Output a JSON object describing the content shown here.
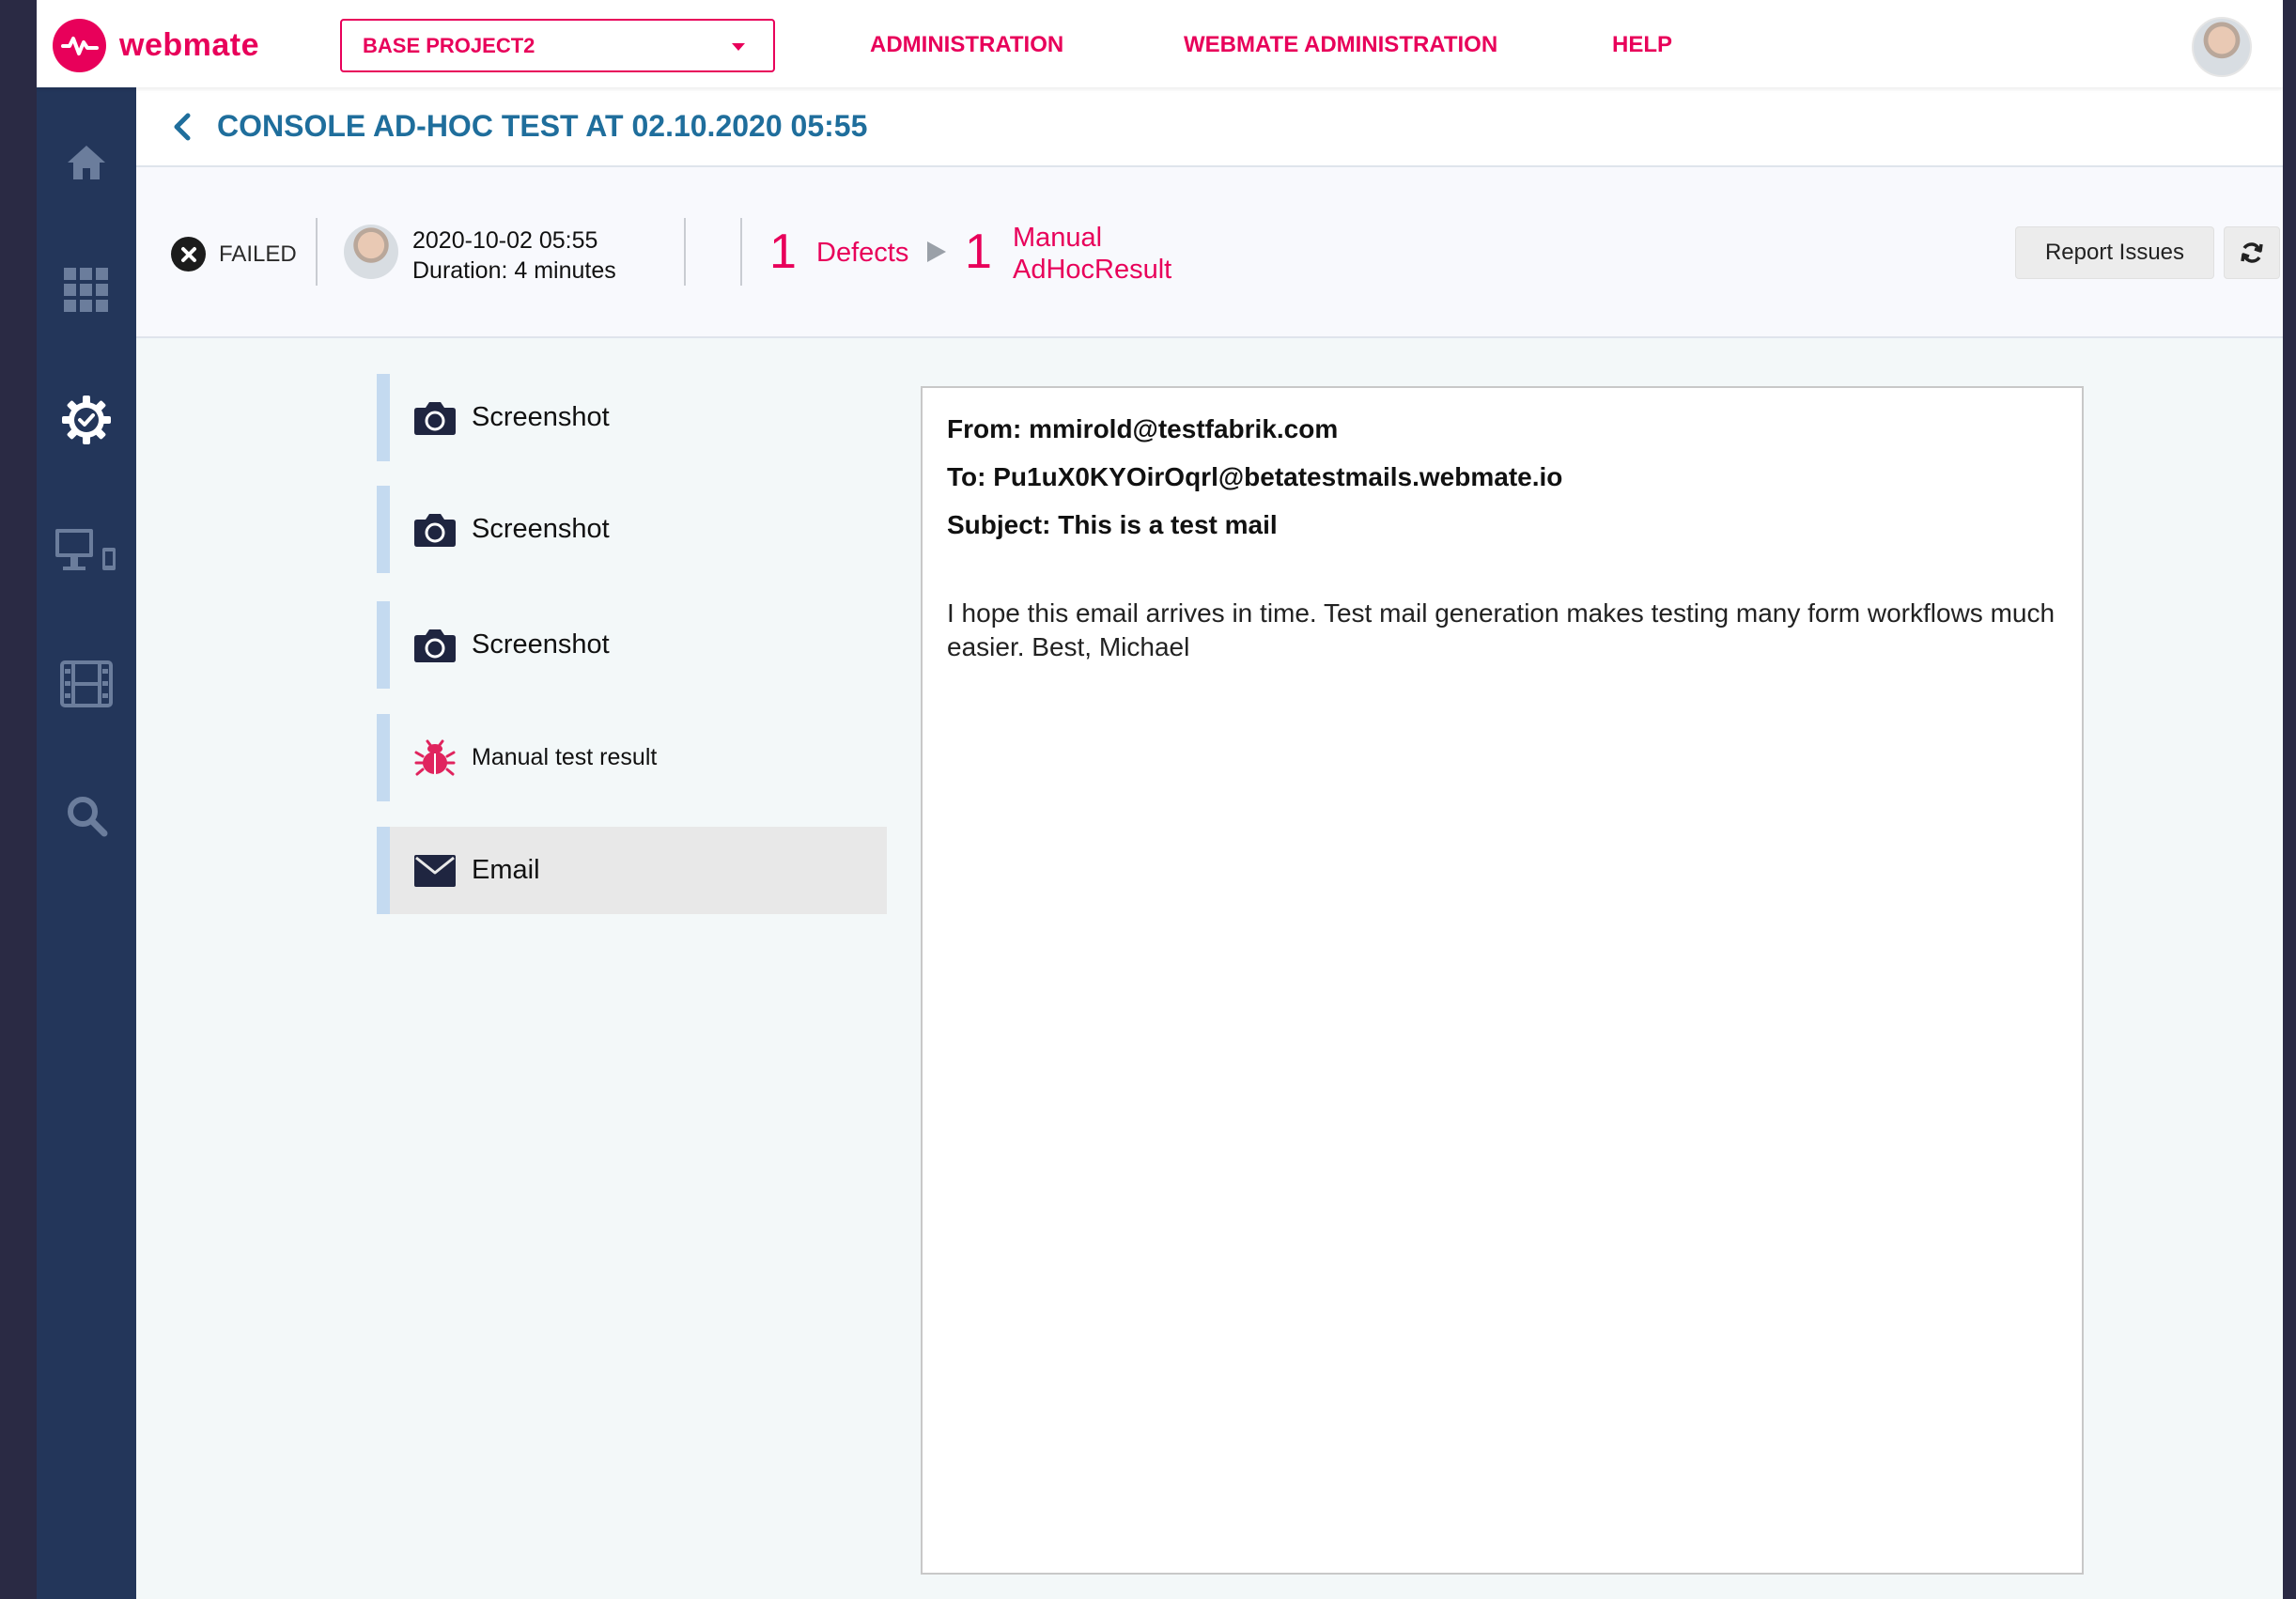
{
  "brand": {
    "name": "webmate",
    "accent_color": "#e8005a",
    "sidebar_color": "#23365a"
  },
  "topbar": {
    "project": "BASE PROJECT2",
    "nav": [
      "ADMINISTRATION",
      "WEBMATE ADMINISTRATION",
      "HELP"
    ]
  },
  "sidebar": {
    "items": [
      {
        "icon": "home-icon"
      },
      {
        "icon": "apps-grid-icon"
      },
      {
        "icon": "settings-check-icon",
        "active": true
      },
      {
        "icon": "devices-icon"
      },
      {
        "icon": "film-icon"
      },
      {
        "icon": "search-icon"
      }
    ]
  },
  "page": {
    "title": "CONSOLE AD-HOC TEST AT 02.10.2020 05:55"
  },
  "status": {
    "state": "FAILED",
    "date": "2020-10-02 05:55",
    "duration": "Duration: 4 minutes",
    "defects_count": "1",
    "defects_label": "Defects",
    "manual_count": "1",
    "manual_label_line1": "Manual",
    "manual_label_line2": "AdHocResult",
    "report_button": "Report Issues"
  },
  "artifacts": [
    {
      "label": "Screenshot",
      "icon": "camera-icon"
    },
    {
      "label": "Screenshot",
      "icon": "camera-icon"
    },
    {
      "label": "Screenshot",
      "icon": "camera-icon"
    },
    {
      "label": "Manual test result",
      "icon": "bug-icon"
    },
    {
      "label": "Email",
      "icon": "envelope-icon",
      "selected": true
    }
  ],
  "email": {
    "from": "From: mmirold@testfabrik.com",
    "to": "To: Pu1uX0KYOirOqrl@betatestmails.webmate.io",
    "subject": "Subject: This is a test mail",
    "body": "I hope this email arrives in time. Test mail generation makes testing many form workflows much easier. Best, Michael"
  }
}
